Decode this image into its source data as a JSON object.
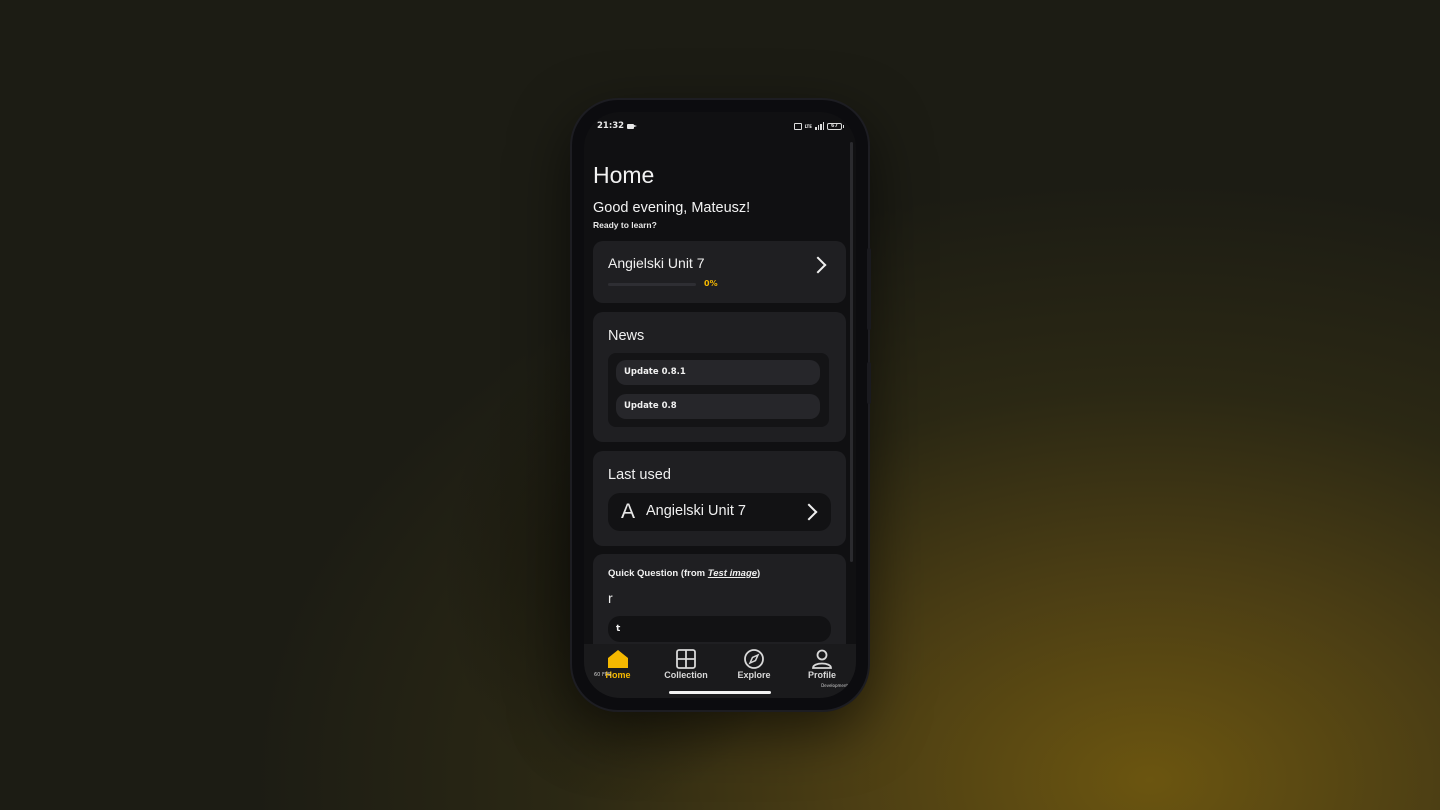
{
  "status": {
    "time": "21:32",
    "battery": "67",
    "network": "LTE"
  },
  "header": {
    "title": "Home",
    "greeting": "Good evening, Mateusz!",
    "subtitle": "Ready to learn?"
  },
  "current_unit": {
    "name": "Angielski Unit 7",
    "progress_pct": 0,
    "progress_text": "0%"
  },
  "news": {
    "title": "News",
    "items": [
      {
        "label": "Update 0.8.1"
      },
      {
        "label": "Update 0.8"
      }
    ]
  },
  "last_used": {
    "title": "Last used",
    "item_letter": "A",
    "item_name": "Angielski Unit 7"
  },
  "quick_question": {
    "prefix": "Quick Question (from ",
    "source": "Test image",
    "suffix": ")",
    "question": "r",
    "answer": "t"
  },
  "nav": {
    "items": [
      {
        "label": "Home",
        "icon": "home-icon",
        "active": true
      },
      {
        "label": "Collection",
        "icon": "grid-icon",
        "active": false
      },
      {
        "label": "Explore",
        "icon": "compass-icon",
        "active": false
      },
      {
        "label": "Profile",
        "icon": "user-icon",
        "active": false
      }
    ]
  },
  "overlay": {
    "fps": "60 FPS",
    "build": "Development"
  },
  "colors": {
    "accent": "#f5b800",
    "card": "#1f1f22",
    "screen": "#101012"
  }
}
